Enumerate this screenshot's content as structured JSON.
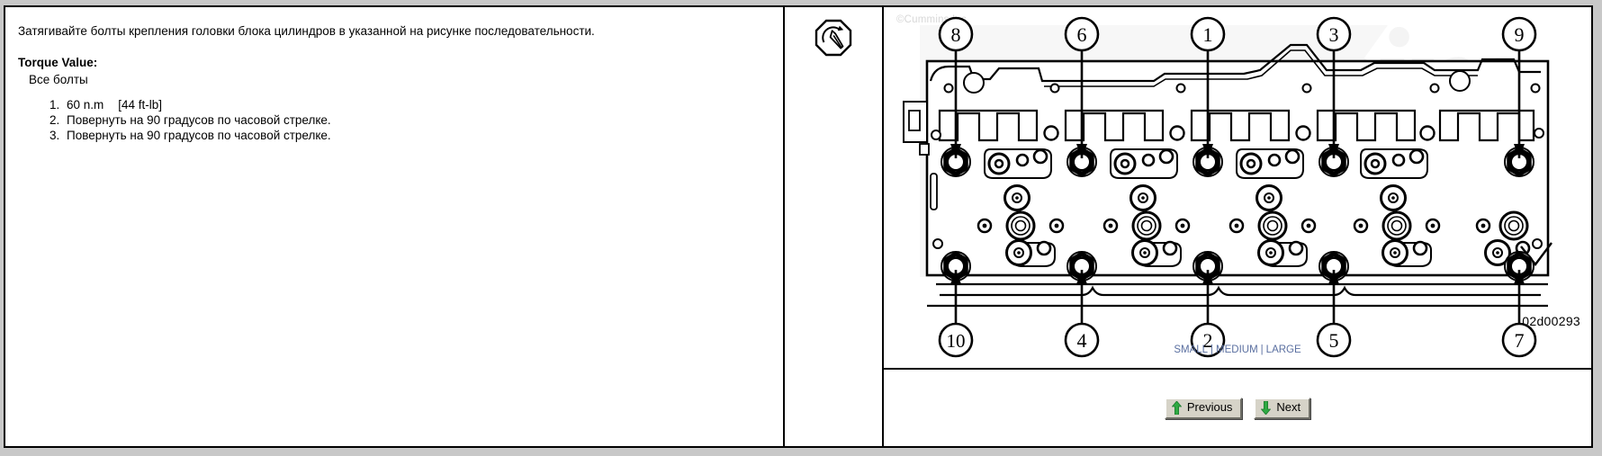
{
  "instruction": {
    "intro": "Затягивайте болты крепления головки блока цилиндров в указанной на рисунке последовательности.",
    "torque_label": "Torque Value:",
    "torque_scope": "Все болты",
    "steps": [
      {
        "value": "60 n.m",
        "alt": "[44 ft-lb]"
      },
      {
        "value": "Повернуть на 90 градусов по часовой стрелке.",
        "alt": ""
      },
      {
        "value": "Повернуть на 90 градусов по часовой стрелке.",
        "alt": ""
      }
    ]
  },
  "icon_column": {
    "icon": "torque-wrench-icon"
  },
  "graphic": {
    "watermark": "©Cummins Inc",
    "brand_watermark": "Cummins",
    "figure_id": "02d00293",
    "callouts_top": [
      "8",
      "6",
      "1",
      "3",
      "9"
    ],
    "callouts_bottom": [
      "10",
      "4",
      "2",
      "5",
      "7"
    ],
    "size_links": {
      "small": "SMALL",
      "medium": "MEDIUM",
      "large": "LARGE",
      "separator": "|"
    }
  },
  "navigation": {
    "previous_label": "Previous",
    "next_label": "Next",
    "previous_icon": "arrow-up-icon",
    "next_icon": "arrow-down-icon"
  },
  "colors": {
    "link": "#5a6fa0",
    "arrow_green": "#2faa43",
    "button_face": "#d6d3c8",
    "page_background": "#c8c8c8",
    "panel_background": "#ffffff",
    "border": "#000000"
  }
}
